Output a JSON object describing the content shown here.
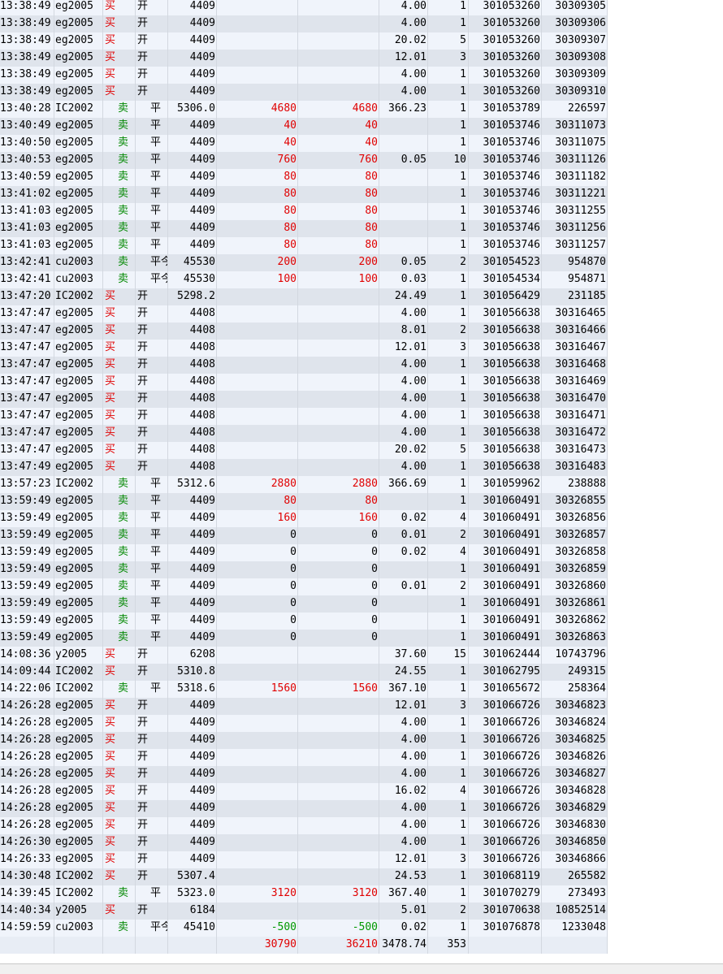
{
  "rows": [
    [
      "13:38:49",
      "eg2005",
      "买",
      "开",
      "4409",
      "",
      "",
      "4.00",
      "1",
      "301053260",
      "30309305"
    ],
    [
      "13:38:49",
      "eg2005",
      "买",
      "开",
      "4409",
      "",
      "",
      "4.00",
      "1",
      "301053260",
      "30309306"
    ],
    [
      "13:38:49",
      "eg2005",
      "买",
      "开",
      "4409",
      "",
      "",
      "20.02",
      "5",
      "301053260",
      "30309307"
    ],
    [
      "13:38:49",
      "eg2005",
      "买",
      "开",
      "4409",
      "",
      "",
      "12.01",
      "3",
      "301053260",
      "30309308"
    ],
    [
      "13:38:49",
      "eg2005",
      "买",
      "开",
      "4409",
      "",
      "",
      "4.00",
      "1",
      "301053260",
      "30309309"
    ],
    [
      "13:38:49",
      "eg2005",
      "买",
      "开",
      "4409",
      "",
      "",
      "4.00",
      "1",
      "301053260",
      "30309310"
    ],
    [
      "13:40:28",
      "IC2002",
      "卖",
      "平",
      "5306.0",
      "4680",
      "4680",
      "366.23",
      "1",
      "301053789",
      "226597"
    ],
    [
      "13:40:49",
      "eg2005",
      "卖",
      "平",
      "4409",
      "40",
      "40",
      "",
      "1",
      "301053746",
      "30311073"
    ],
    [
      "13:40:50",
      "eg2005",
      "卖",
      "平",
      "4409",
      "40",
      "40",
      "",
      "1",
      "301053746",
      "30311075"
    ],
    [
      "13:40:53",
      "eg2005",
      "卖",
      "平",
      "4409",
      "760",
      "760",
      "0.05",
      "10",
      "301053746",
      "30311126"
    ],
    [
      "13:40:59",
      "eg2005",
      "卖",
      "平",
      "4409",
      "80",
      "80",
      "",
      "1",
      "301053746",
      "30311182"
    ],
    [
      "13:41:02",
      "eg2005",
      "卖",
      "平",
      "4409",
      "80",
      "80",
      "",
      "1",
      "301053746",
      "30311221"
    ],
    [
      "13:41:03",
      "eg2005",
      "卖",
      "平",
      "4409",
      "80",
      "80",
      "",
      "1",
      "301053746",
      "30311255"
    ],
    [
      "13:41:03",
      "eg2005",
      "卖",
      "平",
      "4409",
      "80",
      "80",
      "",
      "1",
      "301053746",
      "30311256"
    ],
    [
      "13:41:03",
      "eg2005",
      "卖",
      "平",
      "4409",
      "80",
      "80",
      "",
      "1",
      "301053746",
      "30311257"
    ],
    [
      "13:42:41",
      "cu2003",
      "卖",
      "平今",
      "45530",
      "200",
      "200",
      "0.05",
      "2",
      "301054523",
      "954870"
    ],
    [
      "13:42:41",
      "cu2003",
      "卖",
      "平今",
      "45530",
      "100",
      "100",
      "0.03",
      "1",
      "301054534",
      "954871"
    ],
    [
      "13:47:20",
      "IC2002",
      "买",
      "开",
      "5298.2",
      "",
      "",
      "24.49",
      "1",
      "301056429",
      "231185"
    ],
    [
      "13:47:47",
      "eg2005",
      "买",
      "开",
      "4408",
      "",
      "",
      "4.00",
      "1",
      "301056638",
      "30316465"
    ],
    [
      "13:47:47",
      "eg2005",
      "买",
      "开",
      "4408",
      "",
      "",
      "8.01",
      "2",
      "301056638",
      "30316466"
    ],
    [
      "13:47:47",
      "eg2005",
      "买",
      "开",
      "4408",
      "",
      "",
      "12.01",
      "3",
      "301056638",
      "30316467"
    ],
    [
      "13:47:47",
      "eg2005",
      "买",
      "开",
      "4408",
      "",
      "",
      "4.00",
      "1",
      "301056638",
      "30316468"
    ],
    [
      "13:47:47",
      "eg2005",
      "买",
      "开",
      "4408",
      "",
      "",
      "4.00",
      "1",
      "301056638",
      "30316469"
    ],
    [
      "13:47:47",
      "eg2005",
      "买",
      "开",
      "4408",
      "",
      "",
      "4.00",
      "1",
      "301056638",
      "30316470"
    ],
    [
      "13:47:47",
      "eg2005",
      "买",
      "开",
      "4408",
      "",
      "",
      "4.00",
      "1",
      "301056638",
      "30316471"
    ],
    [
      "13:47:47",
      "eg2005",
      "买",
      "开",
      "4408",
      "",
      "",
      "4.00",
      "1",
      "301056638",
      "30316472"
    ],
    [
      "13:47:47",
      "eg2005",
      "买",
      "开",
      "4408",
      "",
      "",
      "20.02",
      "5",
      "301056638",
      "30316473"
    ],
    [
      "13:47:49",
      "eg2005",
      "买",
      "开",
      "4408",
      "",
      "",
      "4.00",
      "1",
      "301056638",
      "30316483"
    ],
    [
      "13:57:23",
      "IC2002",
      "卖",
      "平",
      "5312.6",
      "2880",
      "2880",
      "366.69",
      "1",
      "301059962",
      "238888"
    ],
    [
      "13:59:49",
      "eg2005",
      "卖",
      "平",
      "4409",
      "80",
      "80",
      "",
      "1",
      "301060491",
      "30326855"
    ],
    [
      "13:59:49",
      "eg2005",
      "卖",
      "平",
      "4409",
      "160",
      "160",
      "0.02",
      "4",
      "301060491",
      "30326856"
    ],
    [
      "13:59:49",
      "eg2005",
      "卖",
      "平",
      "4409",
      "0",
      "0",
      "0.01",
      "2",
      "301060491",
      "30326857"
    ],
    [
      "13:59:49",
      "eg2005",
      "卖",
      "平",
      "4409",
      "0",
      "0",
      "0.02",
      "4",
      "301060491",
      "30326858"
    ],
    [
      "13:59:49",
      "eg2005",
      "卖",
      "平",
      "4409",
      "0",
      "0",
      "",
      "1",
      "301060491",
      "30326859"
    ],
    [
      "13:59:49",
      "eg2005",
      "卖",
      "平",
      "4409",
      "0",
      "0",
      "0.01",
      "2",
      "301060491",
      "30326860"
    ],
    [
      "13:59:49",
      "eg2005",
      "卖",
      "平",
      "4409",
      "0",
      "0",
      "",
      "1",
      "301060491",
      "30326861"
    ],
    [
      "13:59:49",
      "eg2005",
      "卖",
      "平",
      "4409",
      "0",
      "0",
      "",
      "1",
      "301060491",
      "30326862"
    ],
    [
      "13:59:49",
      "eg2005",
      "卖",
      "平",
      "4409",
      "0",
      "0",
      "",
      "1",
      "301060491",
      "30326863"
    ],
    [
      "14:08:36",
      "y2005",
      "买",
      "开",
      "6208",
      "",
      "",
      "37.60",
      "15",
      "301062444",
      "10743796"
    ],
    [
      "14:09:44",
      "IC2002",
      "买",
      "开",
      "5310.8",
      "",
      "",
      "24.55",
      "1",
      "301062795",
      "249315"
    ],
    [
      "14:22:06",
      "IC2002",
      "卖",
      "平",
      "5318.6",
      "1560",
      "1560",
      "367.10",
      "1",
      "301065672",
      "258364"
    ],
    [
      "14:26:28",
      "eg2005",
      "买",
      "开",
      "4409",
      "",
      "",
      "12.01",
      "3",
      "301066726",
      "30346823"
    ],
    [
      "14:26:28",
      "eg2005",
      "买",
      "开",
      "4409",
      "",
      "",
      "4.00",
      "1",
      "301066726",
      "30346824"
    ],
    [
      "14:26:28",
      "eg2005",
      "买",
      "开",
      "4409",
      "",
      "",
      "4.00",
      "1",
      "301066726",
      "30346825"
    ],
    [
      "14:26:28",
      "eg2005",
      "买",
      "开",
      "4409",
      "",
      "",
      "4.00",
      "1",
      "301066726",
      "30346826"
    ],
    [
      "14:26:28",
      "eg2005",
      "买",
      "开",
      "4409",
      "",
      "",
      "4.00",
      "1",
      "301066726",
      "30346827"
    ],
    [
      "14:26:28",
      "eg2005",
      "买",
      "开",
      "4409",
      "",
      "",
      "16.02",
      "4",
      "301066726",
      "30346828"
    ],
    [
      "14:26:28",
      "eg2005",
      "买",
      "开",
      "4409",
      "",
      "",
      "4.00",
      "1",
      "301066726",
      "30346829"
    ],
    [
      "14:26:28",
      "eg2005",
      "买",
      "开",
      "4409",
      "",
      "",
      "4.00",
      "1",
      "301066726",
      "30346830"
    ],
    [
      "14:26:30",
      "eg2005",
      "买",
      "开",
      "4409",
      "",
      "",
      "4.00",
      "1",
      "301066726",
      "30346850"
    ],
    [
      "14:26:33",
      "eg2005",
      "买",
      "开",
      "4409",
      "",
      "",
      "12.01",
      "3",
      "301066726",
      "30346866"
    ],
    [
      "14:30:48",
      "IC2002",
      "买",
      "开",
      "5307.4",
      "",
      "",
      "24.53",
      "1",
      "301068119",
      "265582"
    ],
    [
      "14:39:45",
      "IC2002",
      "卖",
      "平",
      "5323.0",
      "3120",
      "3120",
      "367.40",
      "1",
      "301070279",
      "273493"
    ],
    [
      "14:40:34",
      "y2005",
      "买",
      "开",
      "6184",
      "",
      "",
      "5.01",
      "2",
      "301070638",
      "10852514"
    ],
    [
      "14:59:59",
      "cu2003",
      "卖",
      "平今",
      "45410",
      "-500",
      "-500",
      "0.02",
      "1",
      "301076878",
      "1233048"
    ]
  ],
  "total": {
    "profit_1": "30790",
    "profit_2": "36210",
    "fee": "3478.74",
    "qty": "353"
  },
  "colors": {
    "buy": "#e00000",
    "sell": "#008800",
    "positive": "#e00000",
    "negative": "#009900"
  }
}
